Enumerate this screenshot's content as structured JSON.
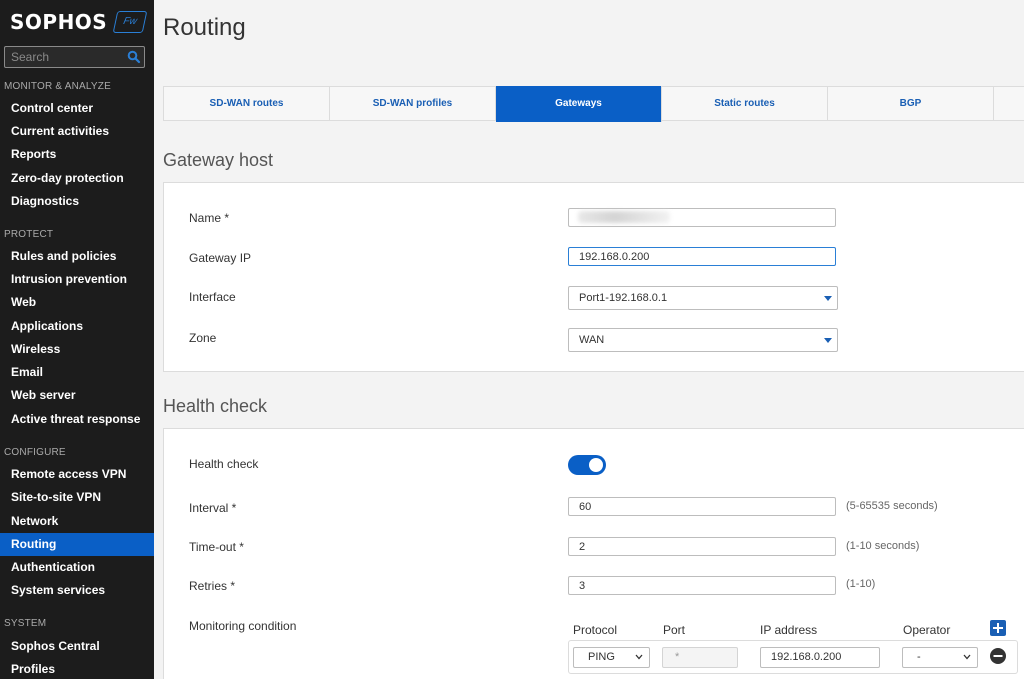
{
  "sidebar": {
    "logo_text": "SOPHOS",
    "logo_badge": "Fw",
    "search_placeholder": "Search",
    "sections": [
      {
        "label": "MONITOR & ANALYZE",
        "items": [
          "Control center",
          "Current activities",
          "Reports",
          "Zero-day protection",
          "Diagnostics"
        ]
      },
      {
        "label": "PROTECT",
        "items": [
          "Rules and policies",
          "Intrusion prevention",
          "Web",
          "Applications",
          "Wireless",
          "Email",
          "Web server",
          "Active threat response"
        ]
      },
      {
        "label": "CONFIGURE",
        "items": [
          "Remote access VPN",
          "Site-to-site VPN",
          "Network",
          "Routing",
          "Authentication",
          "System services"
        ]
      },
      {
        "label": "SYSTEM",
        "items": [
          "Sophos Central",
          "Profiles"
        ]
      }
    ],
    "active_item": "Routing"
  },
  "page": {
    "title": "Routing"
  },
  "tabs": [
    {
      "label": "SD-WAN routes"
    },
    {
      "label": "SD-WAN profiles"
    },
    {
      "label": "Gateways",
      "active": true
    },
    {
      "label": "Static routes"
    },
    {
      "label": "BGP"
    }
  ],
  "gateway_host": {
    "title": "Gateway host",
    "name_label": "Name *",
    "name_value": "",
    "gateway_ip_label": "Gateway IP",
    "gateway_ip_value": "192.168.0.200",
    "interface_label": "Interface",
    "interface_value": "Port1-192.168.0.1",
    "zone_label": "Zone",
    "zone_value": "WAN"
  },
  "health_check": {
    "title": "Health check",
    "enabled_label": "Health check",
    "enabled": true,
    "interval_label": "Interval *",
    "interval_value": "60",
    "interval_hint": "(5-65535 seconds)",
    "timeout_label": "Time-out *",
    "timeout_value": "2",
    "timeout_hint": "(1-10 seconds)",
    "retries_label": "Retries *",
    "retries_value": "3",
    "retries_hint": "(1-10)",
    "monitoring_label": "Monitoring condition",
    "columns": [
      "Protocol",
      "Port",
      "IP address",
      "Operator"
    ],
    "row": {
      "protocol": "PING",
      "port": "*",
      "ip": "192.168.0.200",
      "operator": "-"
    }
  },
  "colors": {
    "accent": "#0a5fc6",
    "sidebar_bg": "#1c1c1c",
    "tab_text": "#1a5fb4"
  }
}
